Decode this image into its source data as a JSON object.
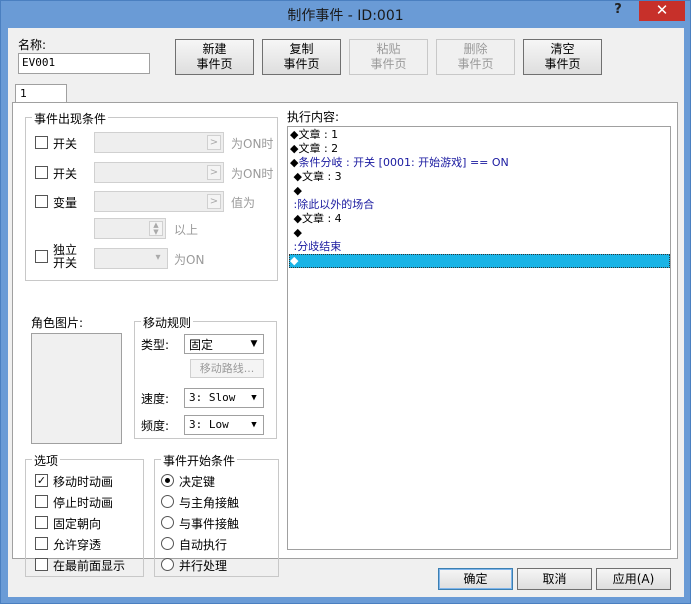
{
  "window": {
    "title": "制作事件 - ID:001",
    "help_label": "?",
    "close_label": "✕"
  },
  "name_label": "名称:",
  "name_value": "EV001",
  "toolbar": {
    "new_page": [
      "新建",
      "事件页"
    ],
    "copy_page": [
      "复制",
      "事件页"
    ],
    "paste_page": [
      "粘贴",
      "事件页"
    ],
    "delete_page": [
      "删除",
      "事件页"
    ],
    "clear_page": [
      "清空",
      "事件页"
    ]
  },
  "tabs": [
    {
      "label": "1"
    }
  ],
  "conditions": {
    "title": "事件出现条件",
    "switch1": {
      "label": "开关",
      "suffix": "为ON时"
    },
    "switch2": {
      "label": "开关",
      "suffix": "为ON时"
    },
    "variable": {
      "label": "变量",
      "suffix": "值为",
      "suffix2": "以上"
    },
    "self_switch": {
      "label": [
        "独立",
        "开关"
      ],
      "value": "",
      "suffix": "为ON"
    }
  },
  "graphic": {
    "title": "角色图片:"
  },
  "movement": {
    "title": "移动规则",
    "type_label": "类型:",
    "type_value": "固定",
    "route_button": "移动路线...",
    "speed_label": "速度:",
    "speed_value": "3: Slow",
    "freq_label": "频度:",
    "freq_value": "3: Low"
  },
  "options": {
    "title": "选项",
    "items": [
      {
        "label": "移动时动画",
        "checked": true
      },
      {
        "label": "停止时动画",
        "checked": false
      },
      {
        "label": "固定朝向",
        "checked": false
      },
      {
        "label": "允许穿透",
        "checked": false
      },
      {
        "label": "在最前面显示",
        "checked": false
      }
    ]
  },
  "trigger": {
    "title": "事件开始条件",
    "items": [
      {
        "label": "决定键",
        "selected": true
      },
      {
        "label": "与主角接触",
        "selected": false
      },
      {
        "label": "与事件接触",
        "selected": false
      },
      {
        "label": "自动执行",
        "selected": false
      },
      {
        "label": "并行处理",
        "selected": false
      }
    ]
  },
  "commands": {
    "title": "执行内容:",
    "lines": [
      {
        "prefix": "◆",
        "text": "文章 : 1"
      },
      {
        "prefix": "◆",
        "text": "文章 : 2"
      },
      {
        "prefix": "◆",
        "text": "条件分岐 : 开关 [0001: 开始游戏] == ON"
      },
      {
        "prefix": " ◆",
        "text": "文章 : 3"
      },
      {
        "prefix": " ◆",
        "text": ""
      },
      {
        "prefix": " :",
        "text": "除此以外的场合"
      },
      {
        "prefix": " ◆",
        "text": "文章 : 4"
      },
      {
        "prefix": " ◆",
        "text": ""
      },
      {
        "prefix": " :",
        "text": "分歧结束"
      },
      {
        "prefix": "◆",
        "text": ""
      }
    ]
  },
  "buttons": {
    "ok": "确定",
    "cancel": "取消",
    "apply": "应用(A)"
  },
  "colors": {
    "frame": "#6a9bd6",
    "close": "#c7302a",
    "selection": "#1ab4e6",
    "command_blue": "#1a1aa0"
  }
}
